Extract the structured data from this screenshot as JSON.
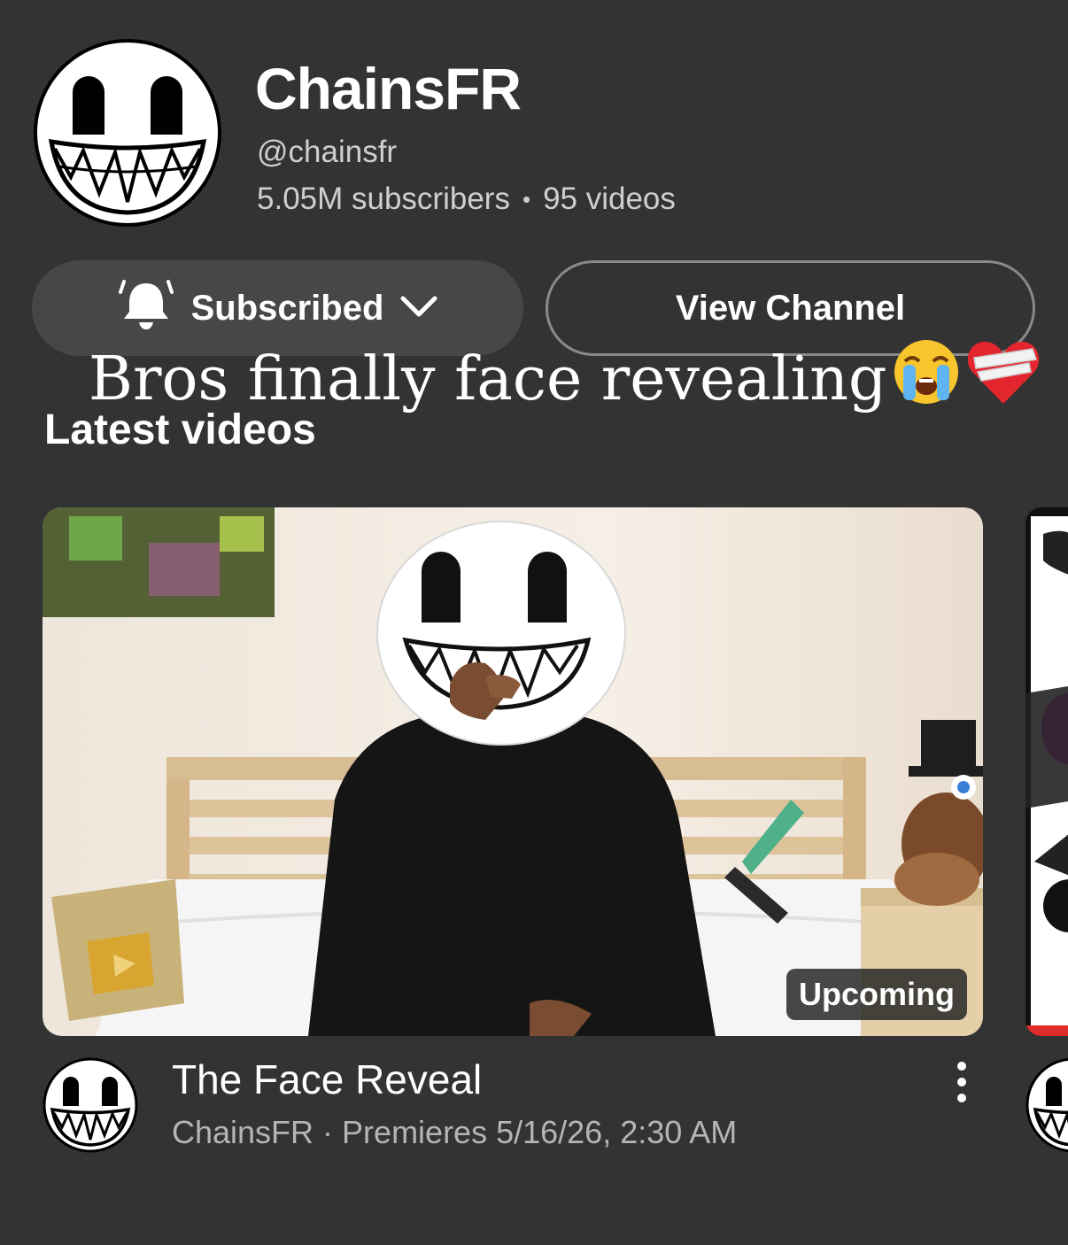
{
  "channel": {
    "name": "ChainsFR",
    "handle": "@chainsfr",
    "subscribers": "5.05M subscribers",
    "separator": "•",
    "videos": "95 videos"
  },
  "actions": {
    "subscribed_label": "Subscribed",
    "view_channel_label": "View Channel"
  },
  "caption": {
    "text": "Bros finally face revealing",
    "emojis": [
      "loudly-crying-face",
      "mending-heart"
    ]
  },
  "section": {
    "title": "Latest videos"
  },
  "video": {
    "badge": "Upcoming",
    "title": "The Face Reveal",
    "subtitle": "ChainsFR · Premieres 5/16/26, 2:30 AM"
  },
  "icons": {
    "bell": "bell-ringing-icon",
    "chevron": "chevron-down-icon",
    "menu": "more-vert-icon"
  },
  "colors": {
    "background": "#333333",
    "button_fill": "#474747",
    "secondary_text": "#cfcfcf"
  }
}
